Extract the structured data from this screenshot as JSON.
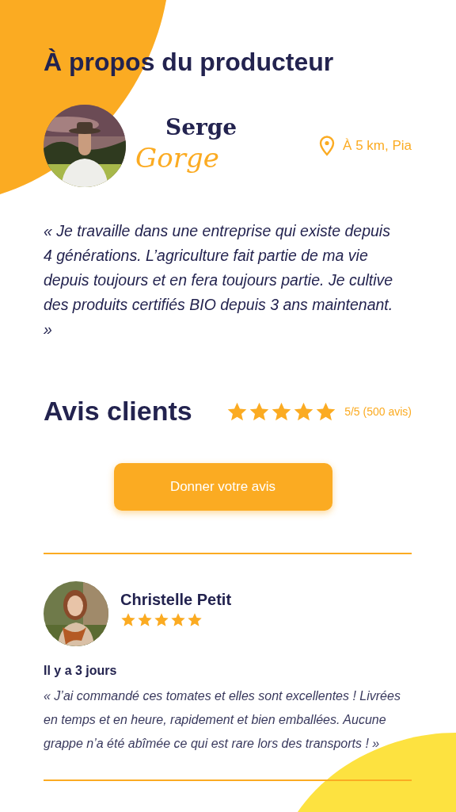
{
  "title": "À propos du producteur",
  "producer": {
    "first_name": "Serge",
    "last_name": "Gorge",
    "location": "À 5 km, Pia"
  },
  "quote": "« Je travaille dans une entreprise qui existe depuis 4 générations. L’agriculture fait partie de ma vie depuis toujours et en fera toujours partie. Je cultive des produits certifiés BIO depuis 3 ans maintenant. »",
  "reviews_section": {
    "title": "Avis clients",
    "stars": 5,
    "rating": "5/5 (500 avis)",
    "button": "Donner votre avis"
  },
  "reviews": [
    {
      "name": "Christelle Petit",
      "stars": 5,
      "date": "Il y a 3 jours",
      "text": "« J’ai commandé ces tomates et elles sont excellentes ! Livrées en temps et en heure, rapidement et bien emballées. Aucune grappe n’a été abîmée ce qui est rare lors des transports ! »"
    }
  ]
}
